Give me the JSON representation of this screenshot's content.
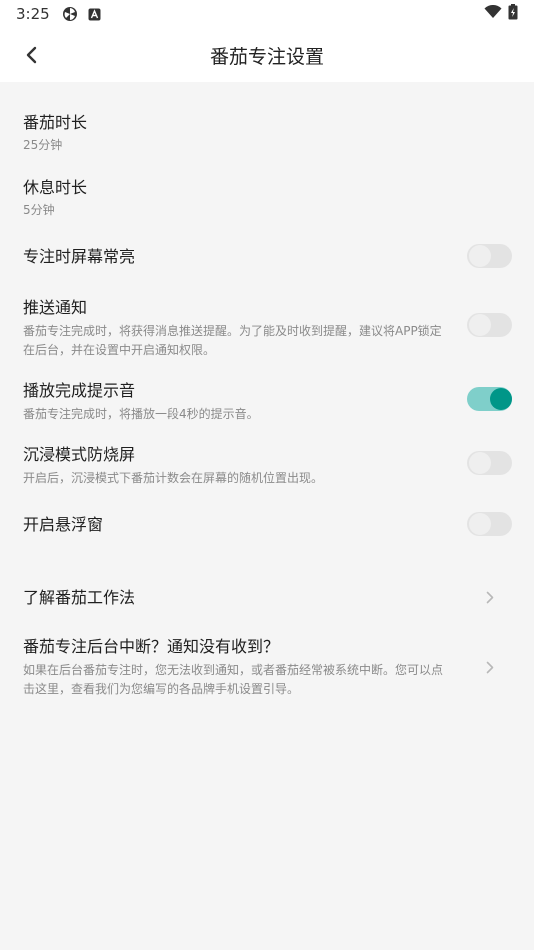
{
  "status_bar": {
    "time": "3:25",
    "icons": [
      "pinwheel-icon",
      "a-badge-icon",
      "wifi-icon",
      "battery-icon"
    ]
  },
  "app_bar": {
    "title": "番茄专注设置",
    "back_icon": "back-arrow-icon"
  },
  "settings": [
    {
      "label": "番茄时长",
      "sub": "25分钟"
    },
    {
      "label": "休息时长",
      "sub": "5分钟"
    },
    {
      "label": "专注时屏幕常亮",
      "toggle": false
    },
    {
      "label": "推送通知",
      "sub": "番茄专注完成时，将获得消息推送提醒。为了能及时收到提醒，建议将APP锁定在后台，并在设置中开启通知权限。",
      "toggle": false
    },
    {
      "label": "播放完成提示音",
      "sub": "番茄专注完成时，将播放一段4秒的提示音。",
      "toggle": true
    },
    {
      "label": "沉浸模式防烧屏",
      "sub": "开启后，沉浸模式下番茄计数会在屏幕的随机位置出现。",
      "toggle": false
    },
    {
      "label": "开启悬浮窗",
      "toggle": false
    },
    {
      "label": "了解番茄工作法"
    },
    {
      "label": "番茄专注后台中断？通知没有收到？",
      "sub": "如果在后台番茄专注时，您无法收到通知，或者番茄经常被系统中断。您可以点击这里，查看我们为您编写的各品牌手机设置引导。"
    }
  ],
  "colors": {
    "accent": "#009688",
    "accent_track": "#7fcfca",
    "toggle_off_track": "#e3e3e3",
    "background": "#f5f5f5"
  }
}
